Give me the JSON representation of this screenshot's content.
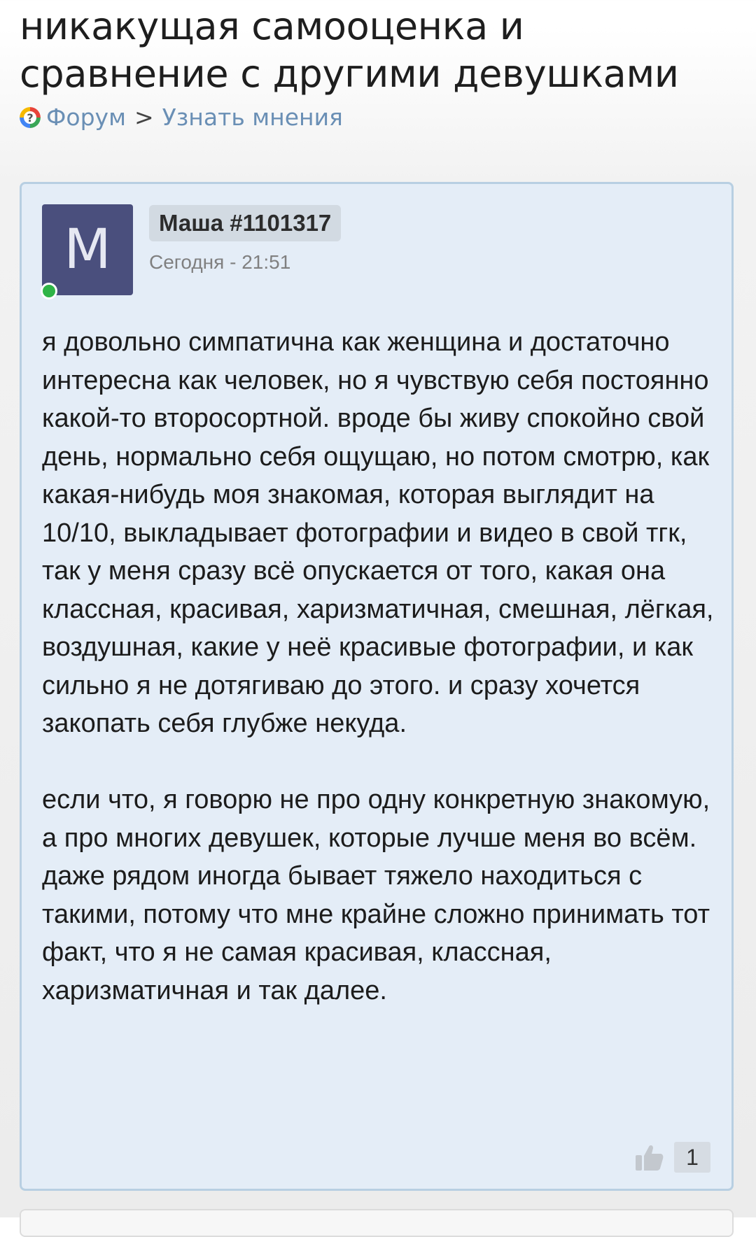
{
  "topic": {
    "title": "никакущая самооценка и сравнение с другими девушками"
  },
  "breadcrumb": {
    "icon": "forum-question-icon",
    "forum_label": "Форум",
    "separator": ">",
    "section_label": "Узнать мнения"
  },
  "post": {
    "avatar_letter": "М",
    "author": "Маша #1101317",
    "timestamp": "Сегодня - 21:51",
    "online": true,
    "paragraphs": [
      "я довольно симпатична как женщина и достаточно интересна как человек, но я чувствую себя постоянно какой-то второсортной. вроде бы живу спокойно свой день, нормально себя ощущаю, но потом смотрю, как какая-нибудь моя знакомая, которая выглядит на 10/10, выкладывает фотографии и видео в свой тгк, так у меня сразу всё опускается от того, какая она классная, красивая, харизматичная, смешная, лёгкая, воздушная, какие у неё красивые фотографии, и как сильно я не дотягиваю до этого. и сразу хочется закопать себя глубже некуда.",
      "если что, я говорю не про одну конкретную знакомую, а про многих девушек, которые лучше меня во всём. даже рядом иногда бывает тяжело находиться с такими, потому что мне крайне сложно принимать тот факт, что я не самая красивая, классная, харизматичная и так далее."
    ],
    "likes": "1",
    "like_icon": "thumbs-up-icon"
  },
  "colors": {
    "card_background": "#e4edf7",
    "card_border": "#b8cfe2",
    "avatar_background": "#4a4f7d",
    "online_dot": "#2fb446",
    "link": "#6a8fb5"
  }
}
